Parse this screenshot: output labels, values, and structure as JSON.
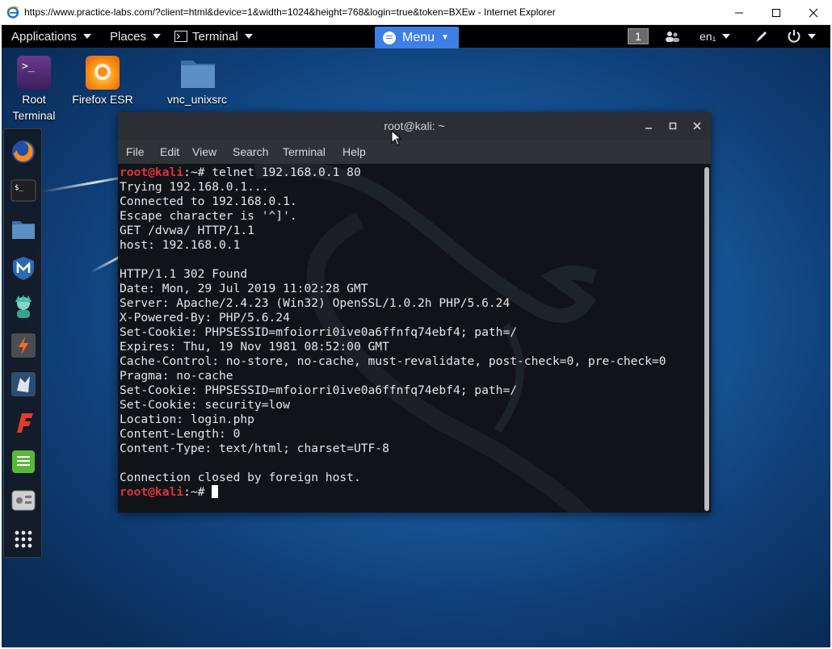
{
  "browser": {
    "title": "https://www.practice-labs.com/?client=html&device=1&width=1024&height=768&login=true&token=BXEw - Internet Explorer",
    "controls": [
      "minimize",
      "maximize",
      "close"
    ]
  },
  "top_panel": {
    "applications": "Applications",
    "places": "Places",
    "terminal": "Terminal",
    "menu": "Menu",
    "workspace": "1",
    "keyboard": "en₁"
  },
  "desktop_icons": [
    {
      "label_line1": "Root",
      "label_line2": "Terminal",
      "icon": "root-terminal-icon"
    },
    {
      "label_line1": "Firefox ESR",
      "label_line2": "",
      "icon": "firefox-icon"
    },
    {
      "label_line1": "vnc_unixsrc",
      "label_line2": "",
      "icon": "folder-icon"
    }
  ],
  "dock": [
    "firefox-icon",
    "terminal-icon",
    "files-icon",
    "metasploit-icon",
    "armitage-icon",
    "burpsuite-icon",
    "beef-icon",
    "faraday-icon",
    "notes-icon",
    "settings-icon",
    "show-apps-icon"
  ],
  "terminal": {
    "title": "root@kali: ~",
    "menu": [
      "File",
      "Edit",
      "View",
      "Search",
      "Terminal",
      "Help"
    ],
    "prompt_user": "root@kali",
    "prompt_rest": ":~# ",
    "command": "telnet 192.168.0.1 80",
    "output": [
      "Trying 192.168.0.1...",
      "Connected to 192.168.0.1.",
      "Escape character is '^]'.",
      "GET /dvwa/ HTTP/1.1",
      "host: 192.168.0.1",
      "",
      "HTTP/1.1 302 Found",
      "Date: Mon, 29 Jul 2019 11:02:28 GMT",
      "Server: Apache/2.4.23 (Win32) OpenSSL/1.0.2h PHP/5.6.24",
      "X-Powered-By: PHP/5.6.24",
      "Set-Cookie: PHPSESSID=mfoiorri0ive0a6ffnfq74ebf4; path=/",
      "Expires: Thu, 19 Nov 1981 08:52:00 GMT",
      "Cache-Control: no-store, no-cache, must-revalidate, post-check=0, pre-check=0",
      "Pragma: no-cache",
      "Set-Cookie: PHPSESSID=mfoiorri0ive0a6ffnfq74ebf4; path=/",
      "Set-Cookie: security=low",
      "Location: login.php",
      "Content-Length: 0",
      "Content-Type: text/html; charset=UTF-8",
      "",
      "Connection closed by foreign host."
    ]
  },
  "colors": {
    "accent": "#3d7fe6",
    "prompt": "#e0323a",
    "terminal_bg": "#101418"
  }
}
